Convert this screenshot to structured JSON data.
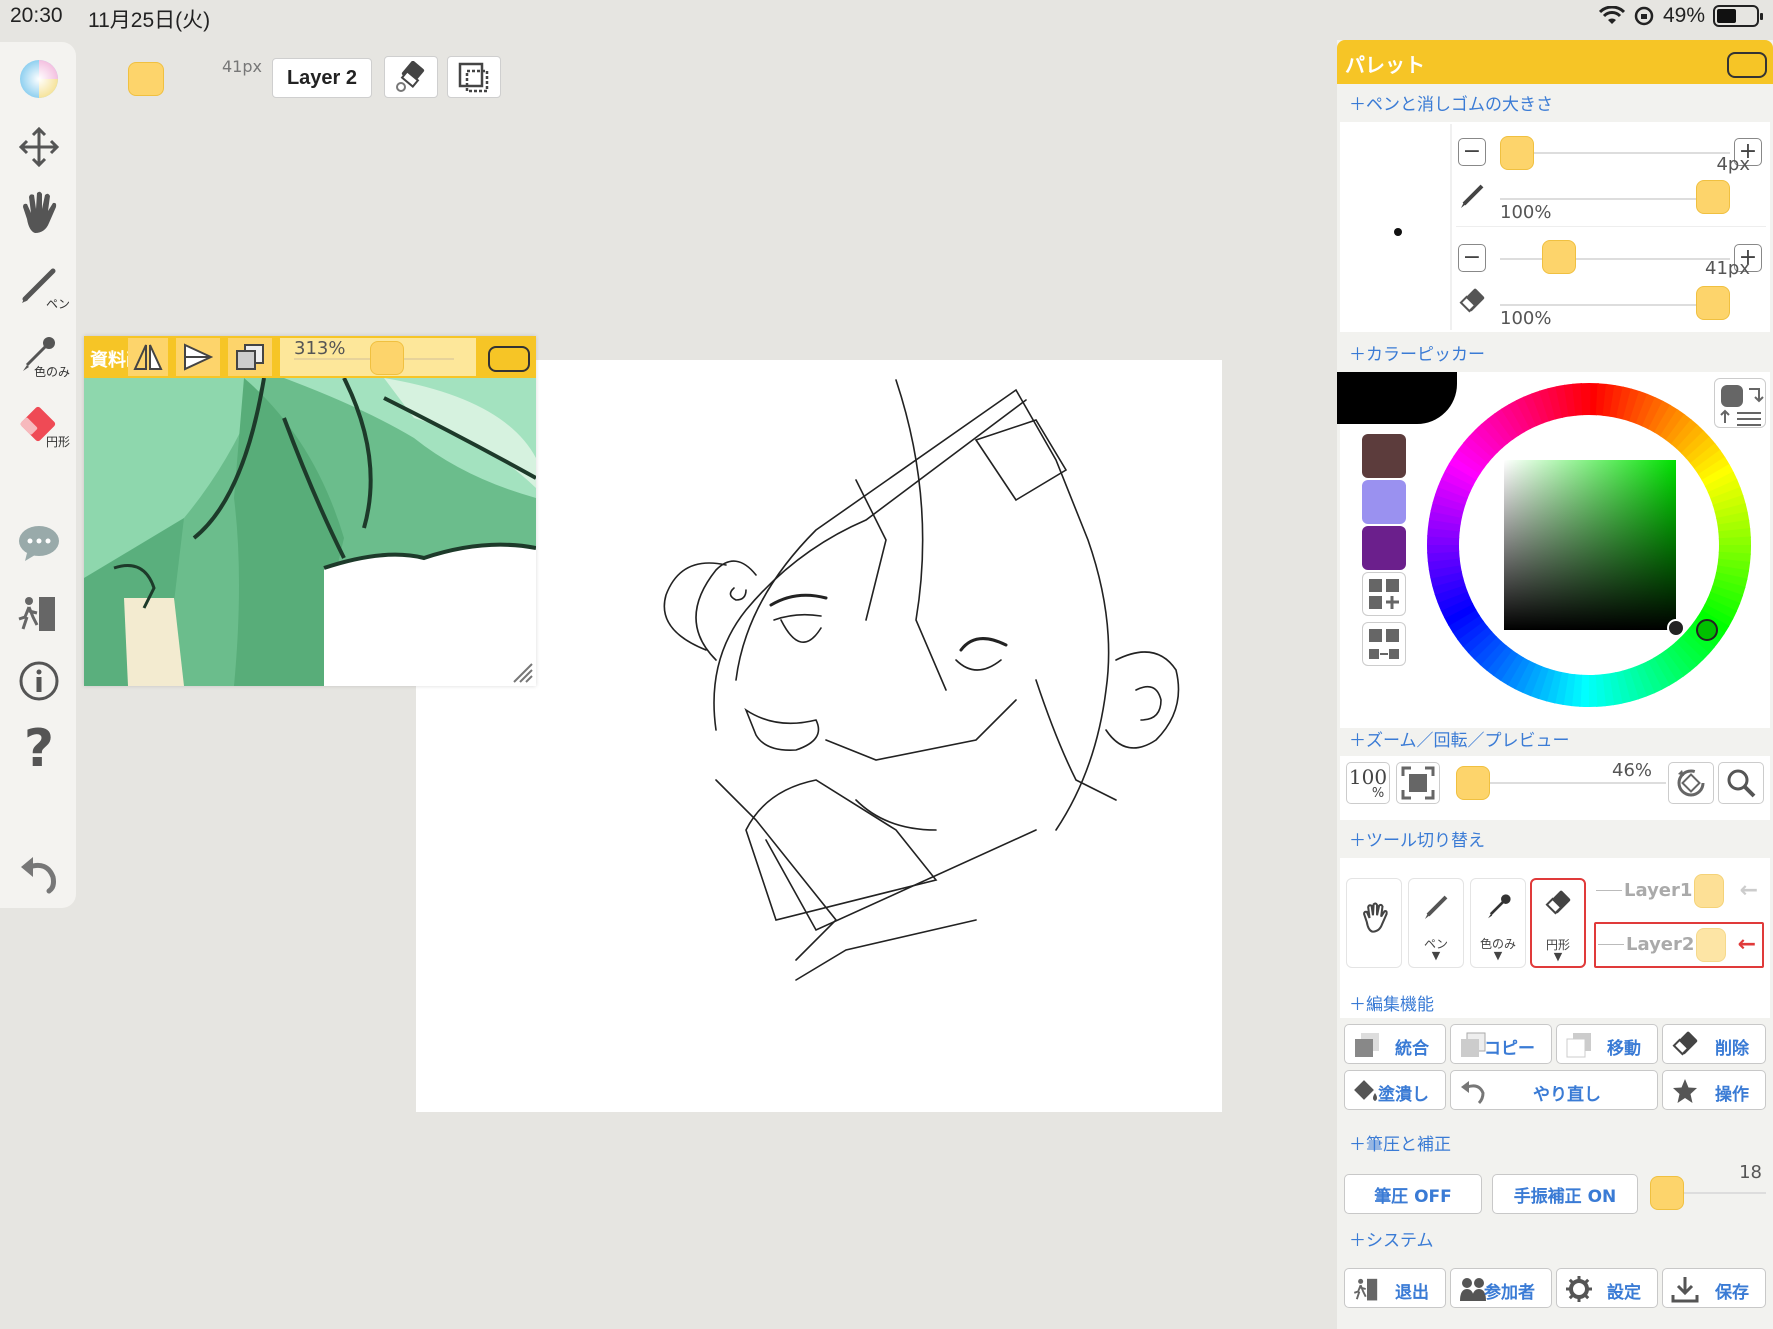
{
  "status": {
    "time": "20:30",
    "date": "11月25日(火)",
    "battery": "49%",
    "battery_level": 0.49
  },
  "left_toolbar": {
    "tools": [
      {
        "name": "color-wheel-icon"
      },
      {
        "name": "move-icon"
      },
      {
        "name": "hand-icon"
      },
      {
        "name": "pen-icon",
        "sub": "ペン"
      },
      {
        "name": "eyedropper-icon",
        "sub": "色のみ"
      },
      {
        "name": "eraser-icon",
        "sub": "円形"
      },
      {
        "name": "chat-icon"
      },
      {
        "name": "exit-icon"
      },
      {
        "name": "info-icon"
      },
      {
        "name": "help-icon"
      },
      {
        "name": "undo-icon"
      }
    ]
  },
  "top_toolbar": {
    "size_label": "41px",
    "layer_label": "Layer 2"
  },
  "reference": {
    "title": "資料画像",
    "zoom": "313%"
  },
  "palette": {
    "title": "パレット",
    "sections": {
      "pen_eraser": "＋ペンと消しゴムの大きさ",
      "color_picker": "＋カラーピッカー",
      "zoom": "＋ズーム／回転／プレビュー",
      "tool_switch": "＋ツール切り替え",
      "edit": "＋編集機能",
      "pressure": "＋筆圧と補正",
      "system": "＋システム"
    },
    "pen": {
      "size": "4px",
      "opacity": "100%"
    },
    "eraser": {
      "size": "41px",
      "opacity": "100%"
    },
    "swatches": [
      "#5c3c3c",
      "#9a91f0",
      "#6b1f8c"
    ],
    "current_color": "#000000",
    "zoom": {
      "reset_label": "100",
      "reset_unit": "%",
      "value": "46%"
    },
    "tool_buttons": [
      {
        "name": "hand",
        "label": ""
      },
      {
        "name": "pen",
        "label": "ペン"
      },
      {
        "name": "eyedropper",
        "label": "色のみ"
      },
      {
        "name": "eraser",
        "label": "円形"
      }
    ],
    "layers": [
      {
        "label": "Layer1"
      },
      {
        "label": "Layer2"
      }
    ],
    "edit_buttons": [
      "統合",
      "コピー",
      "移動",
      "削除"
    ],
    "edit_buttons_row2": [
      "塗潰し",
      "やり直し",
      "操作"
    ],
    "pressure": {
      "pressure_label": "筆圧 OFF",
      "stabilize_label": "手振補正 ON",
      "value": "18"
    },
    "system_buttons": [
      "退出",
      "参加者",
      "設定",
      "保存"
    ],
    "accent": "#f6c526",
    "link": "#3a7bd5",
    "highlight": "#e03a3a"
  }
}
